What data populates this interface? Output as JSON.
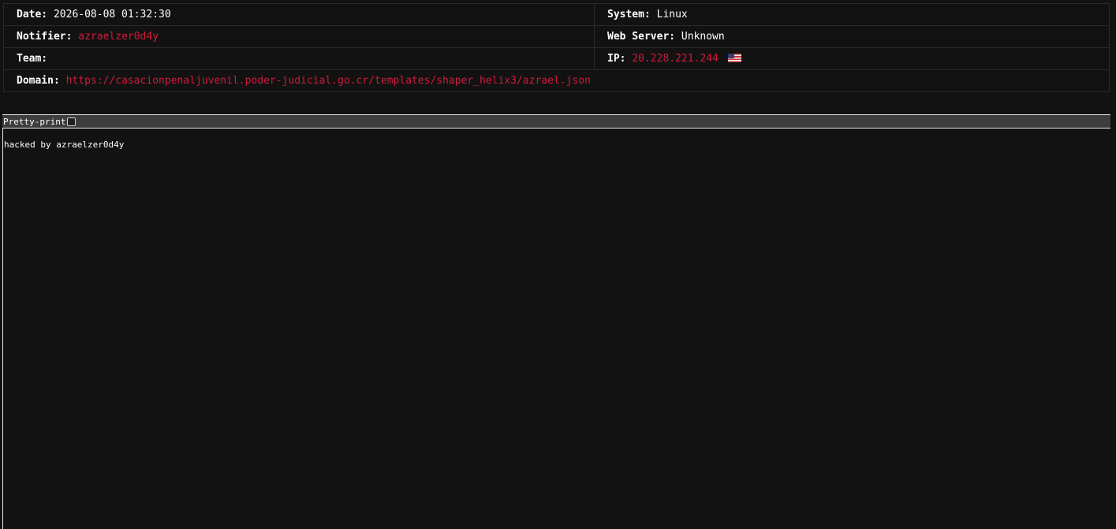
{
  "info": {
    "date_label": "Date:",
    "date_value": "2026-08-08 01:32:30",
    "system_label": "System:",
    "system_value": "Linux",
    "notifier_label": "Notifier:",
    "notifier_value": "azraelzer0d4y",
    "webserver_label": "Web Server:",
    "webserver_value": "Unknown",
    "team_label": "Team:",
    "team_value": "",
    "ip_label": "IP:",
    "ip_value": "20.228.221.244",
    "ip_flag_icon": "us-flag-icon",
    "domain_label": "Domain:",
    "domain_value": "https://casacionpenaljuvenil.poder-judicial.go.cr/templates/shaper_helix3/azrael.json"
  },
  "toolbar": {
    "pretty_print_label": "Pretty-print",
    "pretty_print_checked": false
  },
  "content": {
    "text": "hacked by azraelzer0d4y"
  },
  "colors": {
    "accent": "#d21a3c",
    "background": "#121212",
    "toolbar_bg": "#3d3d3d"
  }
}
